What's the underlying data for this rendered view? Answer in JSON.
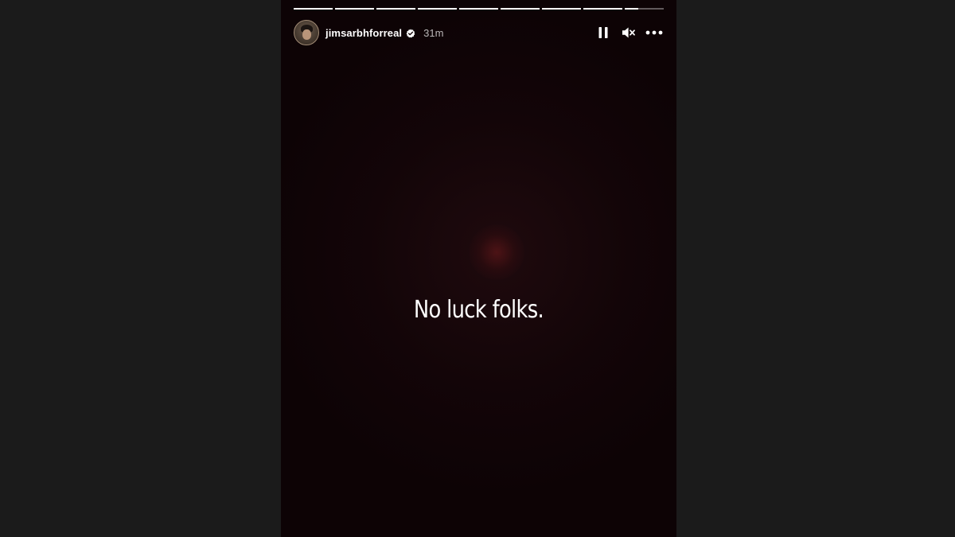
{
  "story": {
    "progress": {
      "segments": [
        1,
        1,
        1,
        1,
        1,
        1,
        1,
        1,
        0.35
      ]
    },
    "header": {
      "username": "jimsarbhforreal",
      "verified": true,
      "time": "31m",
      "avatar_icon": "avatar",
      "pause_icon": "pause-icon",
      "mute_icon": "muted-speaker-icon",
      "more_icon": "more-options-icon"
    },
    "caption": "No luck folks."
  },
  "colors": {
    "page_background": "#1b1b1b",
    "story_background": "#130508",
    "text": "#ffffff",
    "verified_badge": "#ffffff"
  }
}
